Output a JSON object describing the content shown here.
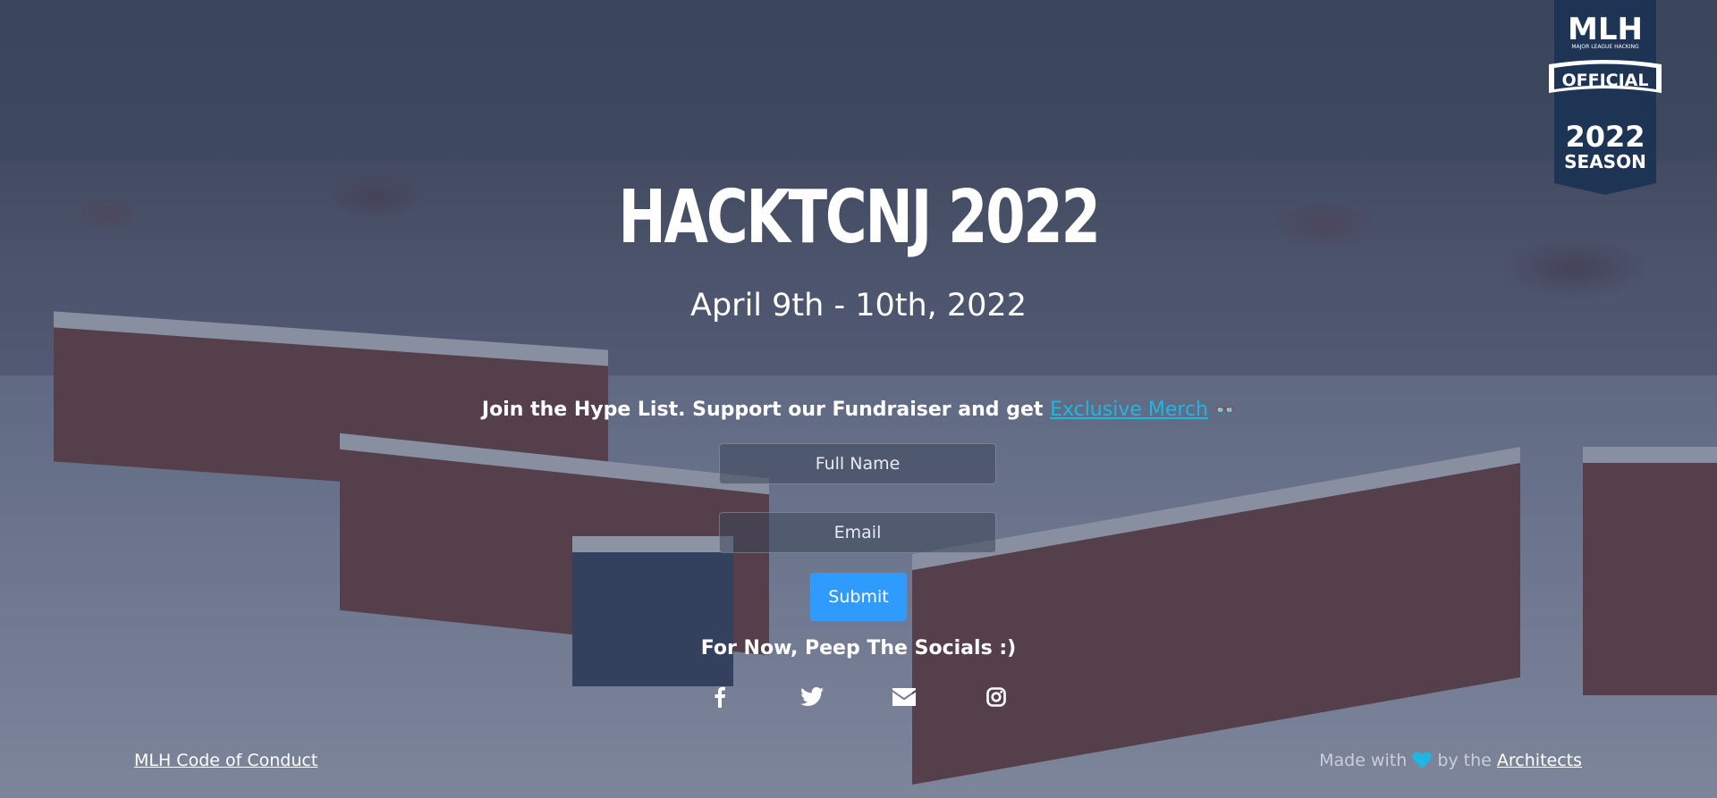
{
  "hero": {
    "title": "HACKTCNJ 2022",
    "date": "April 9th - 10th, 2022"
  },
  "hype": {
    "text": "Join the Hype List. Support our Fundraiser and get ",
    "link_label": "Exclusive Merch",
    "glasses_icon": "👓"
  },
  "form": {
    "name_placeholder": "Full Name",
    "email_placeholder": "Email",
    "submit_label": "Submit"
  },
  "socials": {
    "title": "For Now, Peep The Socials :)",
    "icons": [
      "facebook-icon",
      "twitter-icon",
      "envelope-icon",
      "instagram-icon"
    ]
  },
  "footer": {
    "coc_label": "MLH Code of Conduct",
    "made_with": "Made with",
    "by_the": "by the",
    "architects": "Architects"
  },
  "badge": {
    "mlh": "MLH",
    "subtitle": "MAJOR LEAGUE HACKING",
    "official": "OFFICIAL",
    "year": "2022",
    "season": "SEASON"
  },
  "colors": {
    "accent": "#1fb6e3",
    "button": "#2f9bff",
    "badge": "#1e3455"
  }
}
